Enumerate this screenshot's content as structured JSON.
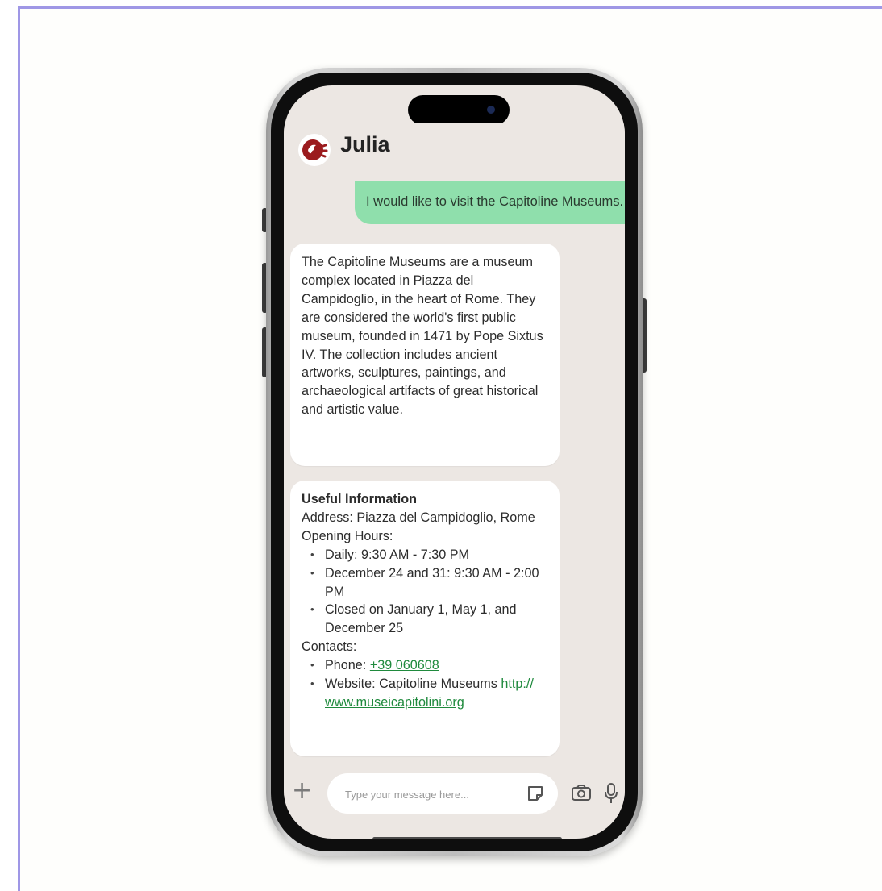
{
  "chat": {
    "contact_name": "Julia",
    "avatar_icon": "julia-logo-icon",
    "brand_color": "#9b1b1e",
    "outgoing_color": "#8fdfac",
    "outgoing_message": "I would like to visit the Capitoline Museums.",
    "description_message": "The Capitoline Museums are a museum complex located in Piazza del Campidoglio, in the heart of Rome. They are considered the world's first public museum, founded in 1471 by Pope Sixtus IV. The collection includes ancient artworks, sculptures, paintings, and archaeological artifacts of great historical and artistic value.",
    "info": {
      "title": "Useful Information",
      "address": "Address: Piazza del Campidoglio, Rome",
      "hours_label": "Opening Hours:",
      "hours": [
        "Daily: 9:30 AM - 7:30 PM",
        "December 24 and 31: 9:30 AM - 2:00 PM",
        "Closed on January 1, May 1, and December 25"
      ],
      "contacts_label": "Contacts:",
      "phone_label": "Phone: ",
      "phone": "+39 060608",
      "website_label": "Website: Capitoline Museums ",
      "website_url_part1": "http://",
      "website_url_part2": "www.museicapitolini.org"
    }
  },
  "composer": {
    "add_icon": "plus-icon",
    "placeholder": "Type your message here...",
    "sticker_icon": "sticker-icon",
    "camera_icon": "camera-icon",
    "mic_icon": "microphone-icon"
  }
}
